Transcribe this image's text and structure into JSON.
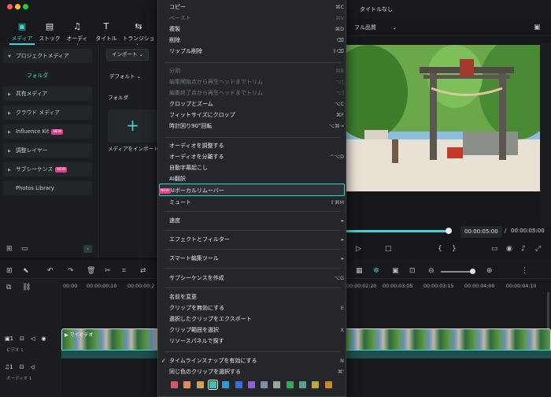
{
  "window": {
    "title": "タイトルなし"
  },
  "toolbar": {
    "tabs": [
      {
        "label": "メディア",
        "icon": "media-icon"
      },
      {
        "label": "ストック",
        "icon": "stock-icon"
      },
      {
        "label": "オーディオ",
        "icon": "audio-icon"
      },
      {
        "label": "タイトル",
        "icon": "title-icon"
      },
      {
        "label": "トランジション",
        "icon": "transition-icon"
      }
    ]
  },
  "sidebar": {
    "items": [
      {
        "label": "プロジェクトメディア"
      },
      {
        "label": "フォルダ"
      },
      {
        "label": "共有メディア"
      },
      {
        "label": "クラウド メディア"
      },
      {
        "label": "Influence Kit",
        "badge": "NEW"
      },
      {
        "label": "調整レイヤー"
      },
      {
        "label": "サブシーケンス",
        "badge": "NEW"
      },
      {
        "label": "Photos Library"
      }
    ]
  },
  "media": {
    "import_label": "インポート",
    "sort_label": "デフォルト",
    "folder_label": "フォルダ",
    "import_media_label": "メディアをインポート"
  },
  "preview": {
    "quality": "フル品質",
    "current_time": "00:00:05:00",
    "total_time": "00:00:05:00",
    "progress": 0.9
  },
  "timeline": {
    "ruler": [
      "00:00",
      "00:00:00:10",
      "00:00:00:2",
      "00:00:02:20",
      "00:00:03:05",
      "00:00:03:15",
      "00:00:04:00",
      "00:00:04:10"
    ],
    "tracks": [
      {
        "label": "ビデオ 1",
        "num": "1"
      },
      {
        "label": "オーディオ 1",
        "num": "1"
      }
    ],
    "clip_label": "マイビデオ"
  },
  "context_menu": {
    "items": [
      {
        "label": "コピー",
        "shortcut": "⌘C",
        "enabled": true
      },
      {
        "label": "ペースト",
        "shortcut": "⌘V",
        "enabled": false
      },
      {
        "label": "複製",
        "shortcut": "⌘D",
        "enabled": true
      },
      {
        "label": "削除",
        "shortcut": "⌫",
        "enabled": true
      },
      {
        "label": "リップル削除",
        "shortcut": "⇧⌫",
        "enabled": true
      },
      {
        "label": "分割",
        "shortcut": "⌘B",
        "enabled": false
      },
      {
        "label": "編集開始点から再生ヘッドまでトリム",
        "shortcut": "⌥[",
        "enabled": false
      },
      {
        "label": "編集終了点から再生ヘッドまでトリム",
        "shortcut": "⌥]",
        "enabled": false
      },
      {
        "label": "クロップとズーム",
        "shortcut": "⌥C",
        "enabled": true
      },
      {
        "label": "フィットサイズにクロップ",
        "shortcut": "⌘F",
        "enabled": true
      },
      {
        "label": "時計回り90°回転",
        "shortcut": "⌥⌘→",
        "enabled": true
      },
      {
        "label": "オーディオを調整する",
        "shortcut": "",
        "enabled": true
      },
      {
        "label": "オーディオを分離する",
        "shortcut": "^⌥D",
        "enabled": true
      },
      {
        "label": "自動字幕起こし",
        "shortcut": "",
        "enabled": true
      },
      {
        "label": "AI翻訳",
        "shortcut": "",
        "enabled": true
      },
      {
        "label": "AIボーカルリムーバー",
        "shortcut": "",
        "enabled": true,
        "badge": "NEW"
      },
      {
        "label": "ミュート",
        "shortcut": "⇧⌘M",
        "enabled": true
      },
      {
        "label": "速度",
        "shortcut": "",
        "enabled": true
      },
      {
        "label": "エフェクトとフィルター",
        "shortcut": "",
        "enabled": true
      },
      {
        "label": "スマート編集ツール",
        "shortcut": "",
        "enabled": true
      },
      {
        "label": "サブシーケンスを作成",
        "shortcut": "⌥G",
        "enabled": true
      },
      {
        "label": "名前を変更",
        "shortcut": "",
        "enabled": true
      },
      {
        "label": "クリップを無効にする",
        "shortcut": "E",
        "enabled": true
      },
      {
        "label": "選択したクリップをエクスポート",
        "shortcut": "",
        "enabled": true
      },
      {
        "label": "クリップ範囲を選択",
        "shortcut": "X",
        "enabled": true
      },
      {
        "label": "リソースパネルで探す",
        "shortcut": "",
        "enabled": true
      },
      {
        "label": "タイムラインスナップを有効にする",
        "shortcut": "N",
        "enabled": true,
        "checked": true
      },
      {
        "label": "同じ色のクリップを選択する",
        "shortcut": "⌘'",
        "enabled": true
      }
    ],
    "colors": [
      "#d0596f",
      "#e08d5e",
      "#c7a35b",
      "#3fc1b5",
      "#2f9ad8",
      "#3b6fd6",
      "#8c60d8",
      "#7f8fa7",
      "#9aa6a3",
      "#3aa657",
      "#5b9f8c",
      "#b7a843",
      "#c28a2a"
    ],
    "selected_color_index": 3
  }
}
